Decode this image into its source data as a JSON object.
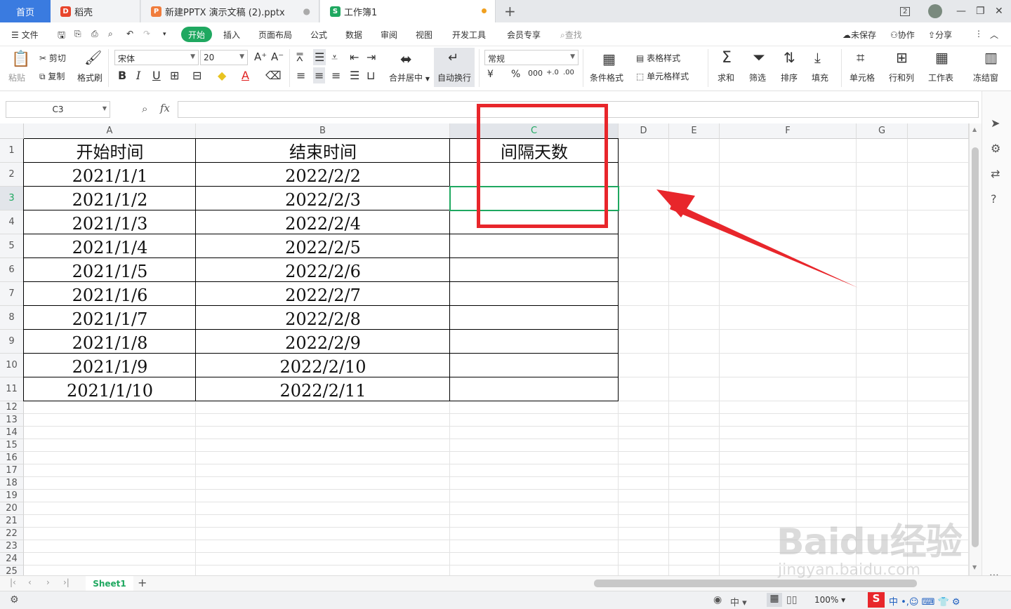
{
  "tabs": {
    "home": "首页",
    "daoke": "稻壳",
    "pptx": "新建PPTX 演示文稿 (2).pptx",
    "workbook": "工作簿1",
    "window_badge": "2"
  },
  "menu": {
    "file": "文件",
    "start": "开始",
    "insert": "插入",
    "page_layout": "页面布局",
    "formula": "公式",
    "data": "数据",
    "review": "审阅",
    "view": "视图",
    "dev_tools": "开发工具",
    "member": "会员专享",
    "search": "查找",
    "unsaved": "未保存",
    "collab": "协作",
    "share": "分享"
  },
  "toolbar": {
    "paste": "粘贴",
    "cut": "剪切",
    "copy": "复制",
    "format_painter": "格式刷",
    "font_name": "宋体",
    "font_size": "20",
    "merge_center": "合并居中",
    "wrap_text": "自动换行",
    "number_format": "常规",
    "conditional_format": "条件格式",
    "table_style": "表格样式",
    "cell_style": "单元格样式",
    "sum": "求和",
    "filter": "筛选",
    "sort": "排序",
    "fill": "填充",
    "cell": "单元格",
    "row_col": "行和列",
    "worksheet": "工作表",
    "freeze": "冻结窗"
  },
  "formula_bar": {
    "cell_ref": "C3",
    "fx": "fx",
    "value": ""
  },
  "columns": [
    "A",
    "B",
    "C",
    "D",
    "E",
    "F",
    "G"
  ],
  "rows": [
    "1",
    "2",
    "3",
    "4",
    "5",
    "6",
    "7",
    "8",
    "9",
    "10",
    "11",
    "12",
    "13",
    "14",
    "15",
    "16",
    "17",
    "18",
    "19",
    "20",
    "21",
    "22",
    "23",
    "24",
    "25"
  ],
  "table": {
    "headers": [
      "开始时间",
      "结束时间",
      "间隔天数"
    ],
    "start_dates": [
      "2021/1/1",
      "2021/1/2",
      "2021/1/3",
      "2021/1/4",
      "2021/1/5",
      "2021/1/6",
      "2021/1/7",
      "2021/1/8",
      "2021/1/9",
      "2021/1/10"
    ],
    "end_dates": [
      "2022/2/2",
      "2022/2/3",
      "2022/2/4",
      "2022/2/5",
      "2022/2/6",
      "2022/2/7",
      "2022/2/8",
      "2022/2/9",
      "2022/2/10",
      "2022/2/11"
    ]
  },
  "sheet": {
    "name": "Sheet1"
  },
  "status": {
    "zoom": "100%",
    "ime": "中"
  },
  "watermark": {
    "brand": "Baidu经验",
    "url": "jingyan.baidu.com"
  },
  "colors": {
    "accent": "#1fa860",
    "tab_active": "#3a7be0",
    "annotation": "#e8262b"
  }
}
